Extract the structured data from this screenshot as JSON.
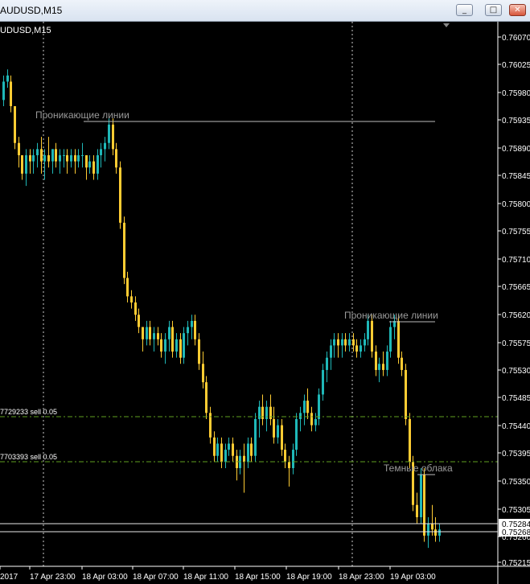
{
  "window": {
    "title": "AUDUSD,M15"
  },
  "chart_header": "UDUSD,M15",
  "buttons": {
    "minimize": "_",
    "restore": "□",
    "close": "✕"
  },
  "colors": {
    "background": "#000000",
    "bull": "#1fb8b8",
    "bear": "#ffcc33",
    "text": "#ffffff",
    "grid_dash": "#ffffff",
    "order_line": "#5fa020",
    "label": "#9a9a9a"
  },
  "price_axis": [
    "0.76070",
    "0.76025",
    "0.75980",
    "0.75935",
    "0.75890",
    "0.75845",
    "0.75800",
    "0.75755",
    "0.75710",
    "0.75665",
    "0.75620",
    "0.75575",
    "0.75530",
    "0.75485",
    "0.75440",
    "0.75395",
    "0.75350",
    "0.75305",
    "0.75260",
    "0.75215"
  ],
  "price_tags": [
    "0.75284",
    "0.75268"
  ],
  "time_axis": [
    "2017",
    "17 Apr 23:00",
    "18 Apr 03:00",
    "18 Apr 07:00",
    "18 Apr 11:00",
    "18 Apr 15:00",
    "18 Apr 19:00",
    "18 Apr 23:00",
    "19 Apr 03:00"
  ],
  "orders": [
    "7729233 sell 0.05",
    "7703393 sell 0.05"
  ],
  "annotations": [
    "Проникающие линии",
    "Проникающие линии",
    "Темные облака"
  ],
  "chart_data": {
    "type": "candlestick",
    "symbol": "AUDUSD",
    "timeframe": "M15",
    "ylim": [
      0.7521,
      0.76095
    ],
    "candles": [
      [
        0.7597,
        0.7601,
        0.7596,
        0.76
      ],
      [
        0.76,
        0.7602,
        0.7599,
        0.7601
      ],
      [
        0.76,
        0.7601,
        0.7595,
        0.7596
      ],
      [
        0.7596,
        0.7596,
        0.7589,
        0.759
      ],
      [
        0.759,
        0.7591,
        0.7586,
        0.7588
      ],
      [
        0.7588,
        0.7588,
        0.7584,
        0.7585
      ],
      [
        0.7585,
        0.7589,
        0.7583,
        0.7588
      ],
      [
        0.7588,
        0.7589,
        0.7585,
        0.7587
      ],
      [
        0.7587,
        0.7589,
        0.7585,
        0.7588
      ],
      [
        0.7588,
        0.759,
        0.7586,
        0.7589
      ],
      [
        0.7589,
        0.7591,
        0.7585,
        0.7587
      ],
      [
        0.7587,
        0.7589,
        0.7584,
        0.7588
      ],
      [
        0.7588,
        0.7591,
        0.7586,
        0.7587
      ],
      [
        0.7587,
        0.7589,
        0.7585,
        0.7589
      ],
      [
        0.7589,
        0.759,
        0.7586,
        0.7587
      ],
      [
        0.7587,
        0.7589,
        0.7585,
        0.7588
      ],
      [
        0.7588,
        0.7589,
        0.7586,
        0.7588
      ],
      [
        0.7588,
        0.7589,
        0.7585,
        0.7587
      ],
      [
        0.7587,
        0.7589,
        0.7586,
        0.7588
      ],
      [
        0.7588,
        0.7589,
        0.7585,
        0.7587
      ],
      [
        0.7587,
        0.7589,
        0.7586,
        0.7588
      ],
      [
        0.7588,
        0.759,
        0.7586,
        0.7588
      ],
      [
        0.7588,
        0.7588,
        0.7584,
        0.7586
      ],
      [
        0.7586,
        0.7588,
        0.7585,
        0.7587
      ],
      [
        0.7587,
        0.7588,
        0.7584,
        0.7585
      ],
      [
        0.7585,
        0.7589,
        0.7584,
        0.7588
      ],
      [
        0.7588,
        0.759,
        0.7586,
        0.7589
      ],
      [
        0.7589,
        0.7591,
        0.7587,
        0.759
      ],
      [
        0.759,
        0.7594,
        0.7589,
        0.7593
      ],
      [
        0.7593,
        0.7594,
        0.7588,
        0.7589
      ],
      [
        0.7589,
        0.759,
        0.7585,
        0.7586
      ],
      [
        0.7586,
        0.7587,
        0.7576,
        0.7577
      ],
      [
        0.7577,
        0.7578,
        0.7567,
        0.7568
      ],
      [
        0.7568,
        0.7569,
        0.7564,
        0.7565
      ],
      [
        0.7565,
        0.7566,
        0.7563,
        0.7564
      ],
      [
        0.7564,
        0.7565,
        0.7561,
        0.7562
      ],
      [
        0.7562,
        0.7563,
        0.7559,
        0.756
      ],
      [
        0.756,
        0.756,
        0.7556,
        0.7558
      ],
      [
        0.7558,
        0.7561,
        0.7557,
        0.756
      ],
      [
        0.756,
        0.7561,
        0.7557,
        0.7558
      ],
      [
        0.7558,
        0.756,
        0.7556,
        0.7559
      ],
      [
        0.7559,
        0.756,
        0.7557,
        0.7558
      ],
      [
        0.7558,
        0.7559,
        0.7555,
        0.7556
      ],
      [
        0.7556,
        0.7559,
        0.7554,
        0.7558
      ],
      [
        0.7558,
        0.7561,
        0.7556,
        0.756
      ],
      [
        0.756,
        0.7561,
        0.7555,
        0.7556
      ],
      [
        0.7556,
        0.7559,
        0.7555,
        0.7558
      ],
      [
        0.7558,
        0.7559,
        0.7554,
        0.7555
      ],
      [
        0.7555,
        0.756,
        0.7554,
        0.7559
      ],
      [
        0.7559,
        0.7561,
        0.7557,
        0.756
      ],
      [
        0.756,
        0.7562,
        0.7558,
        0.7561
      ],
      [
        0.7561,
        0.7562,
        0.7557,
        0.7558
      ],
      [
        0.7558,
        0.7559,
        0.7553,
        0.7554
      ],
      [
        0.7554,
        0.7556,
        0.755,
        0.7551
      ],
      [
        0.7551,
        0.7552,
        0.7545,
        0.7546
      ],
      [
        0.7546,
        0.7547,
        0.7541,
        0.7542
      ],
      [
        0.7542,
        0.7543,
        0.7538,
        0.7539
      ],
      [
        0.7539,
        0.7542,
        0.7538,
        0.7541
      ],
      [
        0.7541,
        0.7542,
        0.7537,
        0.7538
      ],
      [
        0.7538,
        0.7541,
        0.7537,
        0.754
      ],
      [
        0.754,
        0.7542,
        0.7539,
        0.7541
      ],
      [
        0.7541,
        0.7542,
        0.7538,
        0.7539
      ],
      [
        0.7539,
        0.754,
        0.7535,
        0.7537
      ],
      [
        0.7537,
        0.754,
        0.7536,
        0.7539
      ],
      [
        0.7539,
        0.7541,
        0.7533,
        0.7538
      ],
      [
        0.7538,
        0.7542,
        0.7537,
        0.7541
      ],
      [
        0.7541,
        0.7542,
        0.7538,
        0.7539
      ],
      [
        0.7539,
        0.7546,
        0.7538,
        0.7545
      ],
      [
        0.7545,
        0.7548,
        0.7542,
        0.7547
      ],
      [
        0.7547,
        0.7549,
        0.7544,
        0.7545
      ],
      [
        0.7545,
        0.7548,
        0.7543,
        0.7547
      ],
      [
        0.7547,
        0.7549,
        0.7544,
        0.7545
      ],
      [
        0.7545,
        0.7547,
        0.7541,
        0.7542
      ],
      [
        0.7542,
        0.7545,
        0.7541,
        0.7544
      ],
      [
        0.7544,
        0.7545,
        0.7539,
        0.754
      ],
      [
        0.754,
        0.7541,
        0.7537,
        0.7538
      ],
      [
        0.7538,
        0.7539,
        0.7534,
        0.7537
      ],
      [
        0.7537,
        0.7541,
        0.7536,
        0.754
      ],
      [
        0.754,
        0.7546,
        0.7539,
        0.7545
      ],
      [
        0.7545,
        0.7547,
        0.7543,
        0.7546
      ],
      [
        0.7546,
        0.7549,
        0.7544,
        0.7548
      ],
      [
        0.7548,
        0.755,
        0.7545,
        0.7546
      ],
      [
        0.7546,
        0.7547,
        0.7543,
        0.7544
      ],
      [
        0.7544,
        0.7546,
        0.7543,
        0.7545
      ],
      [
        0.7545,
        0.755,
        0.7544,
        0.7549
      ],
      [
        0.7549,
        0.7554,
        0.7548,
        0.7553
      ],
      [
        0.7553,
        0.7556,
        0.7551,
        0.7555
      ],
      [
        0.7555,
        0.7558,
        0.7553,
        0.7557
      ],
      [
        0.7557,
        0.7559,
        0.7555,
        0.7558
      ],
      [
        0.7558,
        0.7559,
        0.7555,
        0.7557
      ],
      [
        0.7557,
        0.7559,
        0.7555,
        0.7558
      ],
      [
        0.7558,
        0.7559,
        0.7556,
        0.7557
      ],
      [
        0.7557,
        0.7559,
        0.7556,
        0.7558
      ],
      [
        0.7558,
        0.7559,
        0.7556,
        0.7557
      ],
      [
        0.7557,
        0.7558,
        0.7555,
        0.7556
      ],
      [
        0.7556,
        0.7558,
        0.7555,
        0.7557
      ],
      [
        0.7557,
        0.7559,
        0.7556,
        0.7558
      ],
      [
        0.7558,
        0.7562,
        0.7557,
        0.7561
      ],
      [
        0.7561,
        0.7562,
        0.7555,
        0.7556
      ],
      [
        0.7556,
        0.7557,
        0.7552,
        0.7553
      ],
      [
        0.7553,
        0.7555,
        0.7551,
        0.7554
      ],
      [
        0.7554,
        0.7556,
        0.7552,
        0.7553
      ],
      [
        0.7553,
        0.7557,
        0.7552,
        0.7556
      ],
      [
        0.7556,
        0.7561,
        0.7555,
        0.756
      ],
      [
        0.756,
        0.7562,
        0.7558,
        0.7561
      ],
      [
        0.7561,
        0.7562,
        0.7554,
        0.7555
      ],
      [
        0.7555,
        0.7556,
        0.7552,
        0.7553
      ],
      [
        0.7553,
        0.7554,
        0.7544,
        0.7545
      ],
      [
        0.7545,
        0.7546,
        0.7537,
        0.7538
      ],
      [
        0.7538,
        0.7539,
        0.753,
        0.7531
      ],
      [
        0.7531,
        0.7533,
        0.7528,
        0.7529
      ],
      [
        0.7529,
        0.7537,
        0.7528,
        0.7536
      ],
      [
        0.7536,
        0.7537,
        0.7525,
        0.7526
      ],
      [
        0.7526,
        0.7529,
        0.7524,
        0.7528
      ],
      [
        0.7528,
        0.7531,
        0.7526,
        0.7527
      ],
      [
        0.7527,
        0.7529,
        0.7525,
        0.7526
      ],
      [
        0.7526,
        0.7528,
        0.7525,
        0.7527
      ]
    ]
  }
}
